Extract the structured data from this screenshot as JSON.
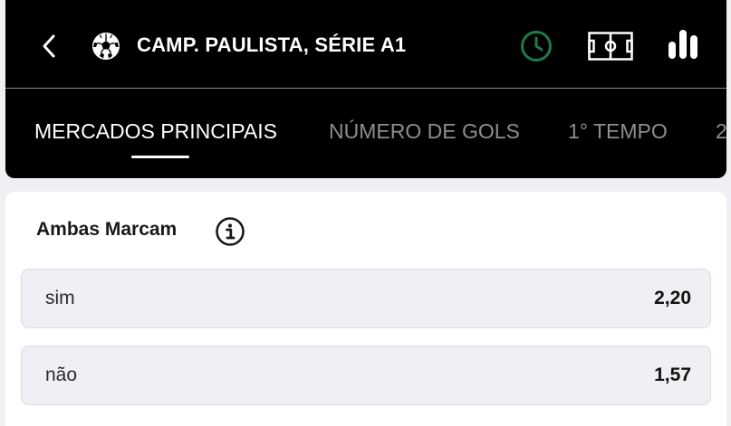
{
  "header": {
    "title": "CAMP. PAULISTA, SÉRIE A1",
    "back_icon": "chevron-left-icon",
    "sport_icon": "soccer-ball-icon",
    "actions": [
      {
        "icon": "clock-icon",
        "color": "#1f7a4a"
      },
      {
        "icon": "field-icon",
        "color": "#ffffff"
      },
      {
        "icon": "stats-icon",
        "color": "#ffffff"
      }
    ]
  },
  "tabs": [
    {
      "label": "MERCADOS PRINCIPAIS",
      "active": true
    },
    {
      "label": "NÚMERO DE GOLS",
      "active": false
    },
    {
      "label": "1° TEMPO",
      "active": false
    },
    {
      "label": "2",
      "active": false
    }
  ],
  "market": {
    "title": "Ambas Marcam",
    "info_icon": "info-icon",
    "options": [
      {
        "label": "sim",
        "odd": "2,20"
      },
      {
        "label": "não",
        "odd": "1,57"
      }
    ]
  },
  "colors": {
    "header_bg": "#000000",
    "accent_green": "#1f7a4a",
    "page_bg": "#eef0f3"
  }
}
